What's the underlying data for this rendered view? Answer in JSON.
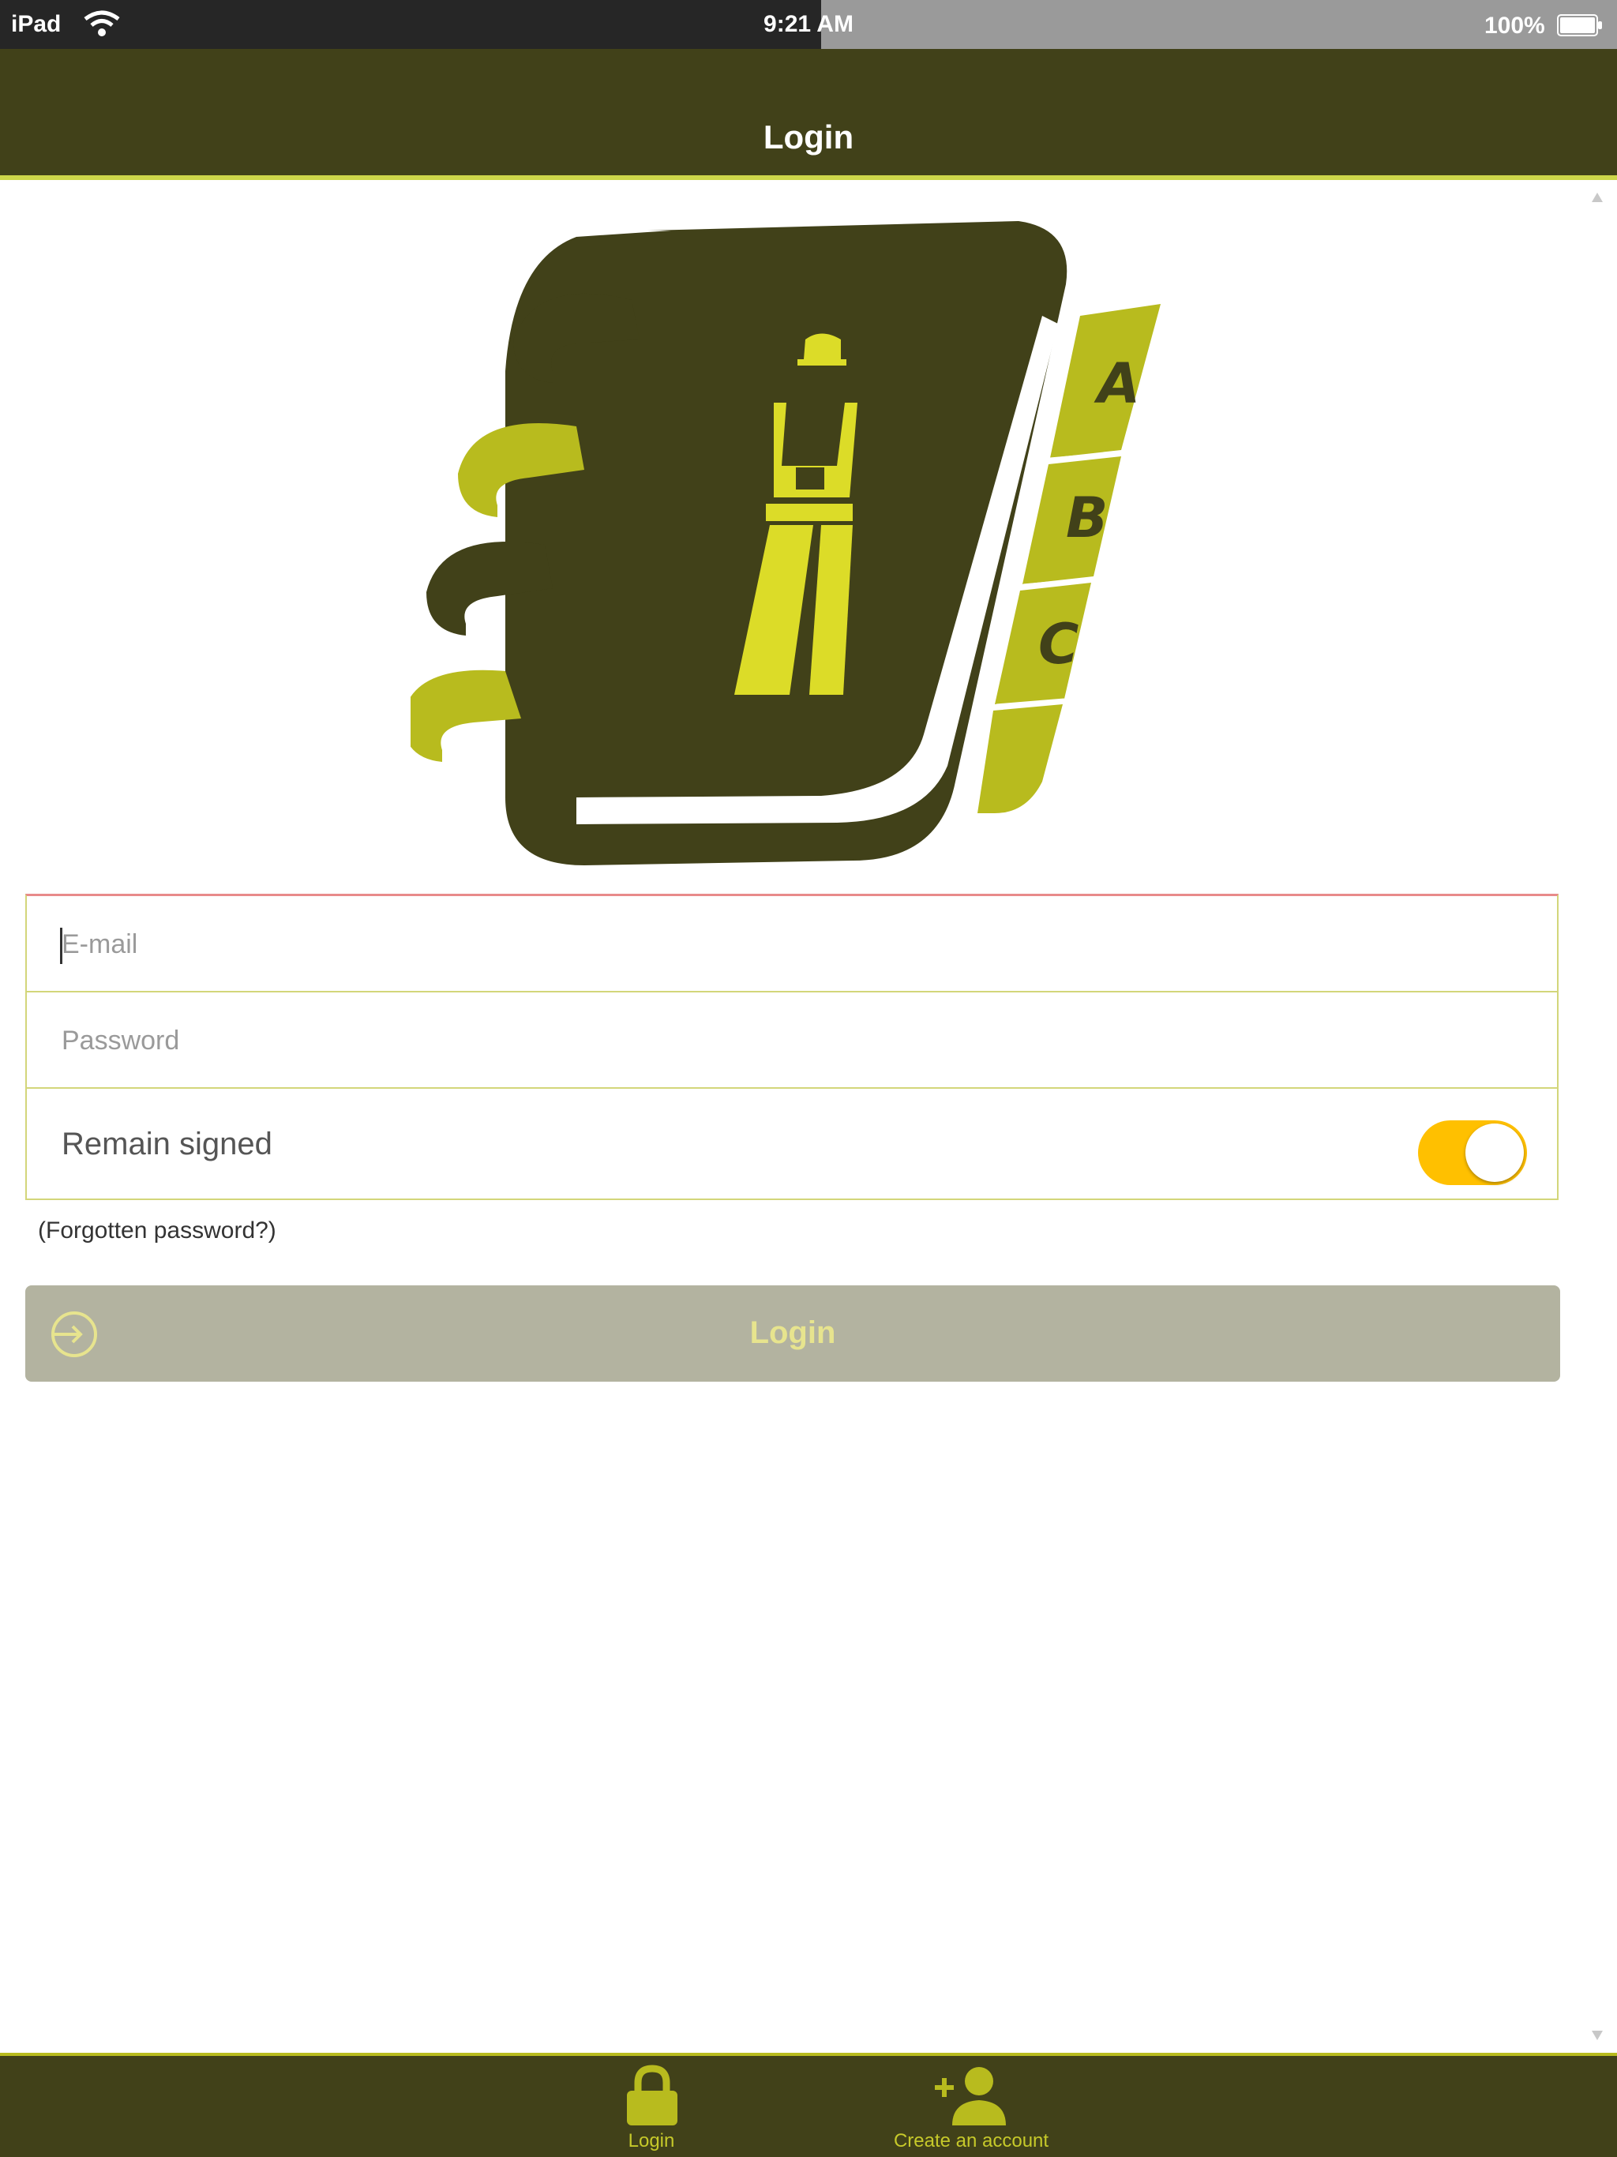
{
  "status_bar": {
    "device": "iPad",
    "time": "9:21 AM",
    "battery": "100%"
  },
  "nav": {
    "title": "Login"
  },
  "logo": {
    "tabs": [
      "A",
      "B",
      "C"
    ]
  },
  "form": {
    "email_placeholder": "E-mail",
    "email_value": "",
    "password_placeholder": "Password",
    "password_value": "",
    "remember_label": "Remain signed",
    "remember_on": true,
    "forgot_label": "(Forgotten password?)"
  },
  "login_button": {
    "label": "Login"
  },
  "tab_bar": {
    "items": [
      {
        "label": "Login",
        "icon": "lock-icon"
      },
      {
        "label": "Create an account",
        "icon": "add-user-icon"
      }
    ]
  },
  "colors": {
    "nav_bg": "#414119",
    "accent": "#cdd64a",
    "toggle_on": "#ffc000",
    "button_disabled": "#b3b3a0"
  }
}
